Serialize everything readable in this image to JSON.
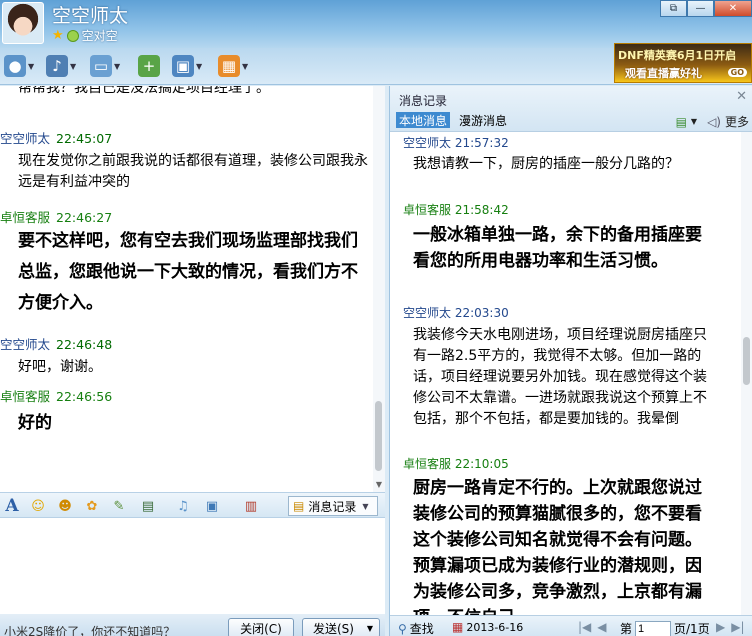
{
  "window": {
    "title": "空空师太",
    "signature": "空对空",
    "controls": [
      "⧉",
      "—",
      "✕"
    ]
  },
  "toolbar": {
    "items": [
      {
        "name": "video",
        "icon": "camera-icon",
        "color": "#5b93c9"
      },
      {
        "name": "voice",
        "icon": "microphone-icon",
        "color": "#4f7fb3"
      },
      {
        "name": "file",
        "icon": "folder-icon",
        "color": "#6aa0d2"
      },
      {
        "name": "message",
        "icon": "message-add-icon",
        "color": "#59a447"
      },
      {
        "name": "remote",
        "icon": "monitor-icon",
        "color": "#4e86c1"
      },
      {
        "name": "apps",
        "icon": "apps-grid-icon",
        "color": "#e88c2b"
      }
    ]
  },
  "ad": {
    "line1": "DNF精英赛6月1日开启",
    "line2": "观看直播赢好礼",
    "go": "GO"
  },
  "chat": {
    "partial_top": "帮帮我？我自己是没法搞定项目经理了。",
    "messages": [
      {
        "name": "空空师太",
        "time": "22:45:07",
        "text": "现在发觉你之前跟我说的话都很有道理，装修公司跟我永远是有利益冲突的"
      },
      {
        "name": "卓恒客服",
        "time": "22:46:27",
        "text": "要不这样吧，您有空去我们现场监理部找我们总监，您跟他说一下大致的情况，看我们方不方便介入。"
      },
      {
        "name": "空空师太",
        "time": "22:46:48",
        "text": "好吧，谢谢。"
      },
      {
        "name": "卓恒客服",
        "time": "22:46:56",
        "text": "好的"
      }
    ]
  },
  "input_toolbar": {
    "history_label": "消息记录"
  },
  "bottom": {
    "tip": "小米2S降价了，你还不知道吗？",
    "close_label": "关闭(C)",
    "send_label": "发送(S)"
  },
  "history": {
    "title": "消息记录",
    "tabs": [
      "本地消息",
      "漫游消息"
    ],
    "more_label": "更多",
    "messages": [
      {
        "name": "空空师太",
        "time": "21:57:32",
        "text": "我想请教一下，厨房的插座一般分几路的？"
      },
      {
        "name": "卓恒客服",
        "time": "21:58:42",
        "text": "一般冰箱单独一路，余下的备用插座要看您的所用电器功率和生活习惯。"
      },
      {
        "name": "空空师太",
        "time": "22:03:30",
        "text": "我装修今天水电刚进场，项目经理说厨房插座只有一路2.5平方的，我觉得不太够。但加一路的话，项目经理说要另外加钱。现在感觉得这个装修公司不太靠谱。一进场就跟我说这个预算上不包括，那个不包括，都是要加钱的。我晕倒"
      },
      {
        "name": "卓恒客服",
        "time": "22:10:05",
        "text": "厨房一路肯定不行的。上次就跟您说过装修公司的预算猫腻很多的，您不要看这个装修公司知名就觉得不会有问题。预算漏项已成为装修行业的潜规则，因为装修公司多，竞争激烈，上京都有漏项，不信自己..."
      }
    ],
    "footer": {
      "search_label": "查找",
      "date": "2013-6-16",
      "page_prefix": "第",
      "page_value": "1",
      "page_suffix": "页/1页"
    }
  }
}
